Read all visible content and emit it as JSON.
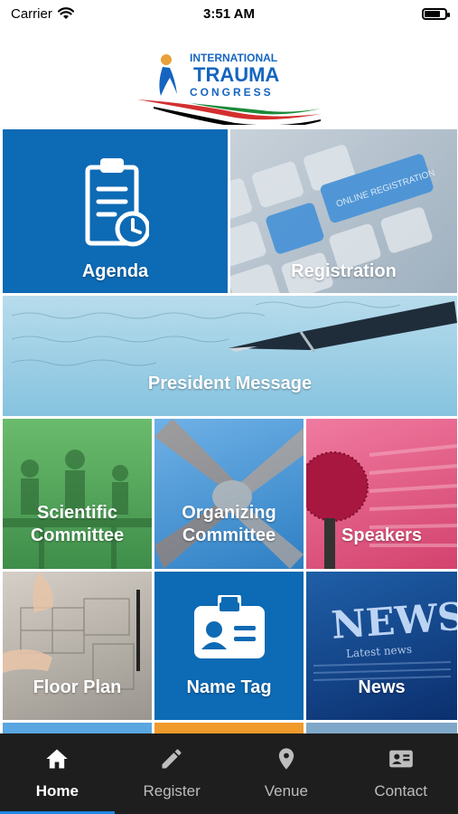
{
  "status_bar": {
    "carrier": "Carrier",
    "time": "3:51 AM",
    "battery_level": 0.85
  },
  "header": {
    "logo": {
      "line1": "INTERNATIONAL",
      "line2": "TRAUMA",
      "line3": "CONGRESS"
    }
  },
  "tiles": [
    {
      "label": "Agenda",
      "icon": "clipboard-clock-icon"
    },
    {
      "label": "Registration",
      "icon": "keyboard-registration-photo"
    },
    {
      "label": "President Message",
      "icon": "fountain-pen-photo"
    },
    {
      "label_line1": "Scientific",
      "label_line2": "Committee",
      "icon": "meeting-photo"
    },
    {
      "label_line1": "Organizing",
      "label_line2": "Committee",
      "icon": "hands-together-photo"
    },
    {
      "label": "Speakers",
      "icon": "microphone-photo"
    },
    {
      "label": "Floor Plan",
      "icon": "blueprint-photo"
    },
    {
      "label": "Name Tag",
      "icon": "id-badge-icon"
    },
    {
      "label": "News",
      "icon": "newspaper-photo"
    }
  ],
  "photo_text": {
    "registration_key": "ONLINE REGISTRATION",
    "news_banner": "NEWS",
    "news_sub": "Latest news"
  },
  "bottom_nav": [
    {
      "label": "Home",
      "icon": "home-icon",
      "active": true
    },
    {
      "label": "Register",
      "icon": "pencil-icon",
      "active": false
    },
    {
      "label": "Venue",
      "icon": "location-pin-icon",
      "active": false
    },
    {
      "label": "Contact",
      "icon": "contact-card-icon",
      "active": false
    }
  ],
  "colors": {
    "primary_blue": "#0d6ab4",
    "nav_bg": "#1e1e1e",
    "nav_accent": "#1e88e5"
  }
}
